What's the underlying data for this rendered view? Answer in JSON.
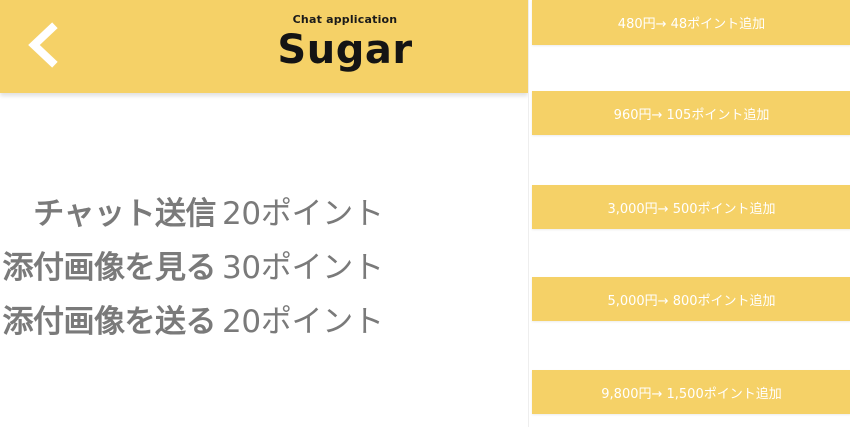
{
  "header": {
    "subtitle": "Chat application",
    "title": "Sugar",
    "back_icon": "chevron-left-icon",
    "color": "#f5d167"
  },
  "costs": [
    {
      "label": "チャット送信",
      "points": "20ポイント"
    },
    {
      "label": "添付画像を見る",
      "points": "30ポイント"
    },
    {
      "label": "添付画像を送る",
      "points": "20ポイント"
    }
  ],
  "purchase_options": [
    {
      "label": "480円→ 48ポイント追加"
    },
    {
      "label": "960円→ 105ポイント追加"
    },
    {
      "label": "3,000円→ 500ポイント追加"
    },
    {
      "label": "5,000円→ 800ポイント追加"
    },
    {
      "label": "9,800円→ 1,500ポイント追加"
    }
  ]
}
